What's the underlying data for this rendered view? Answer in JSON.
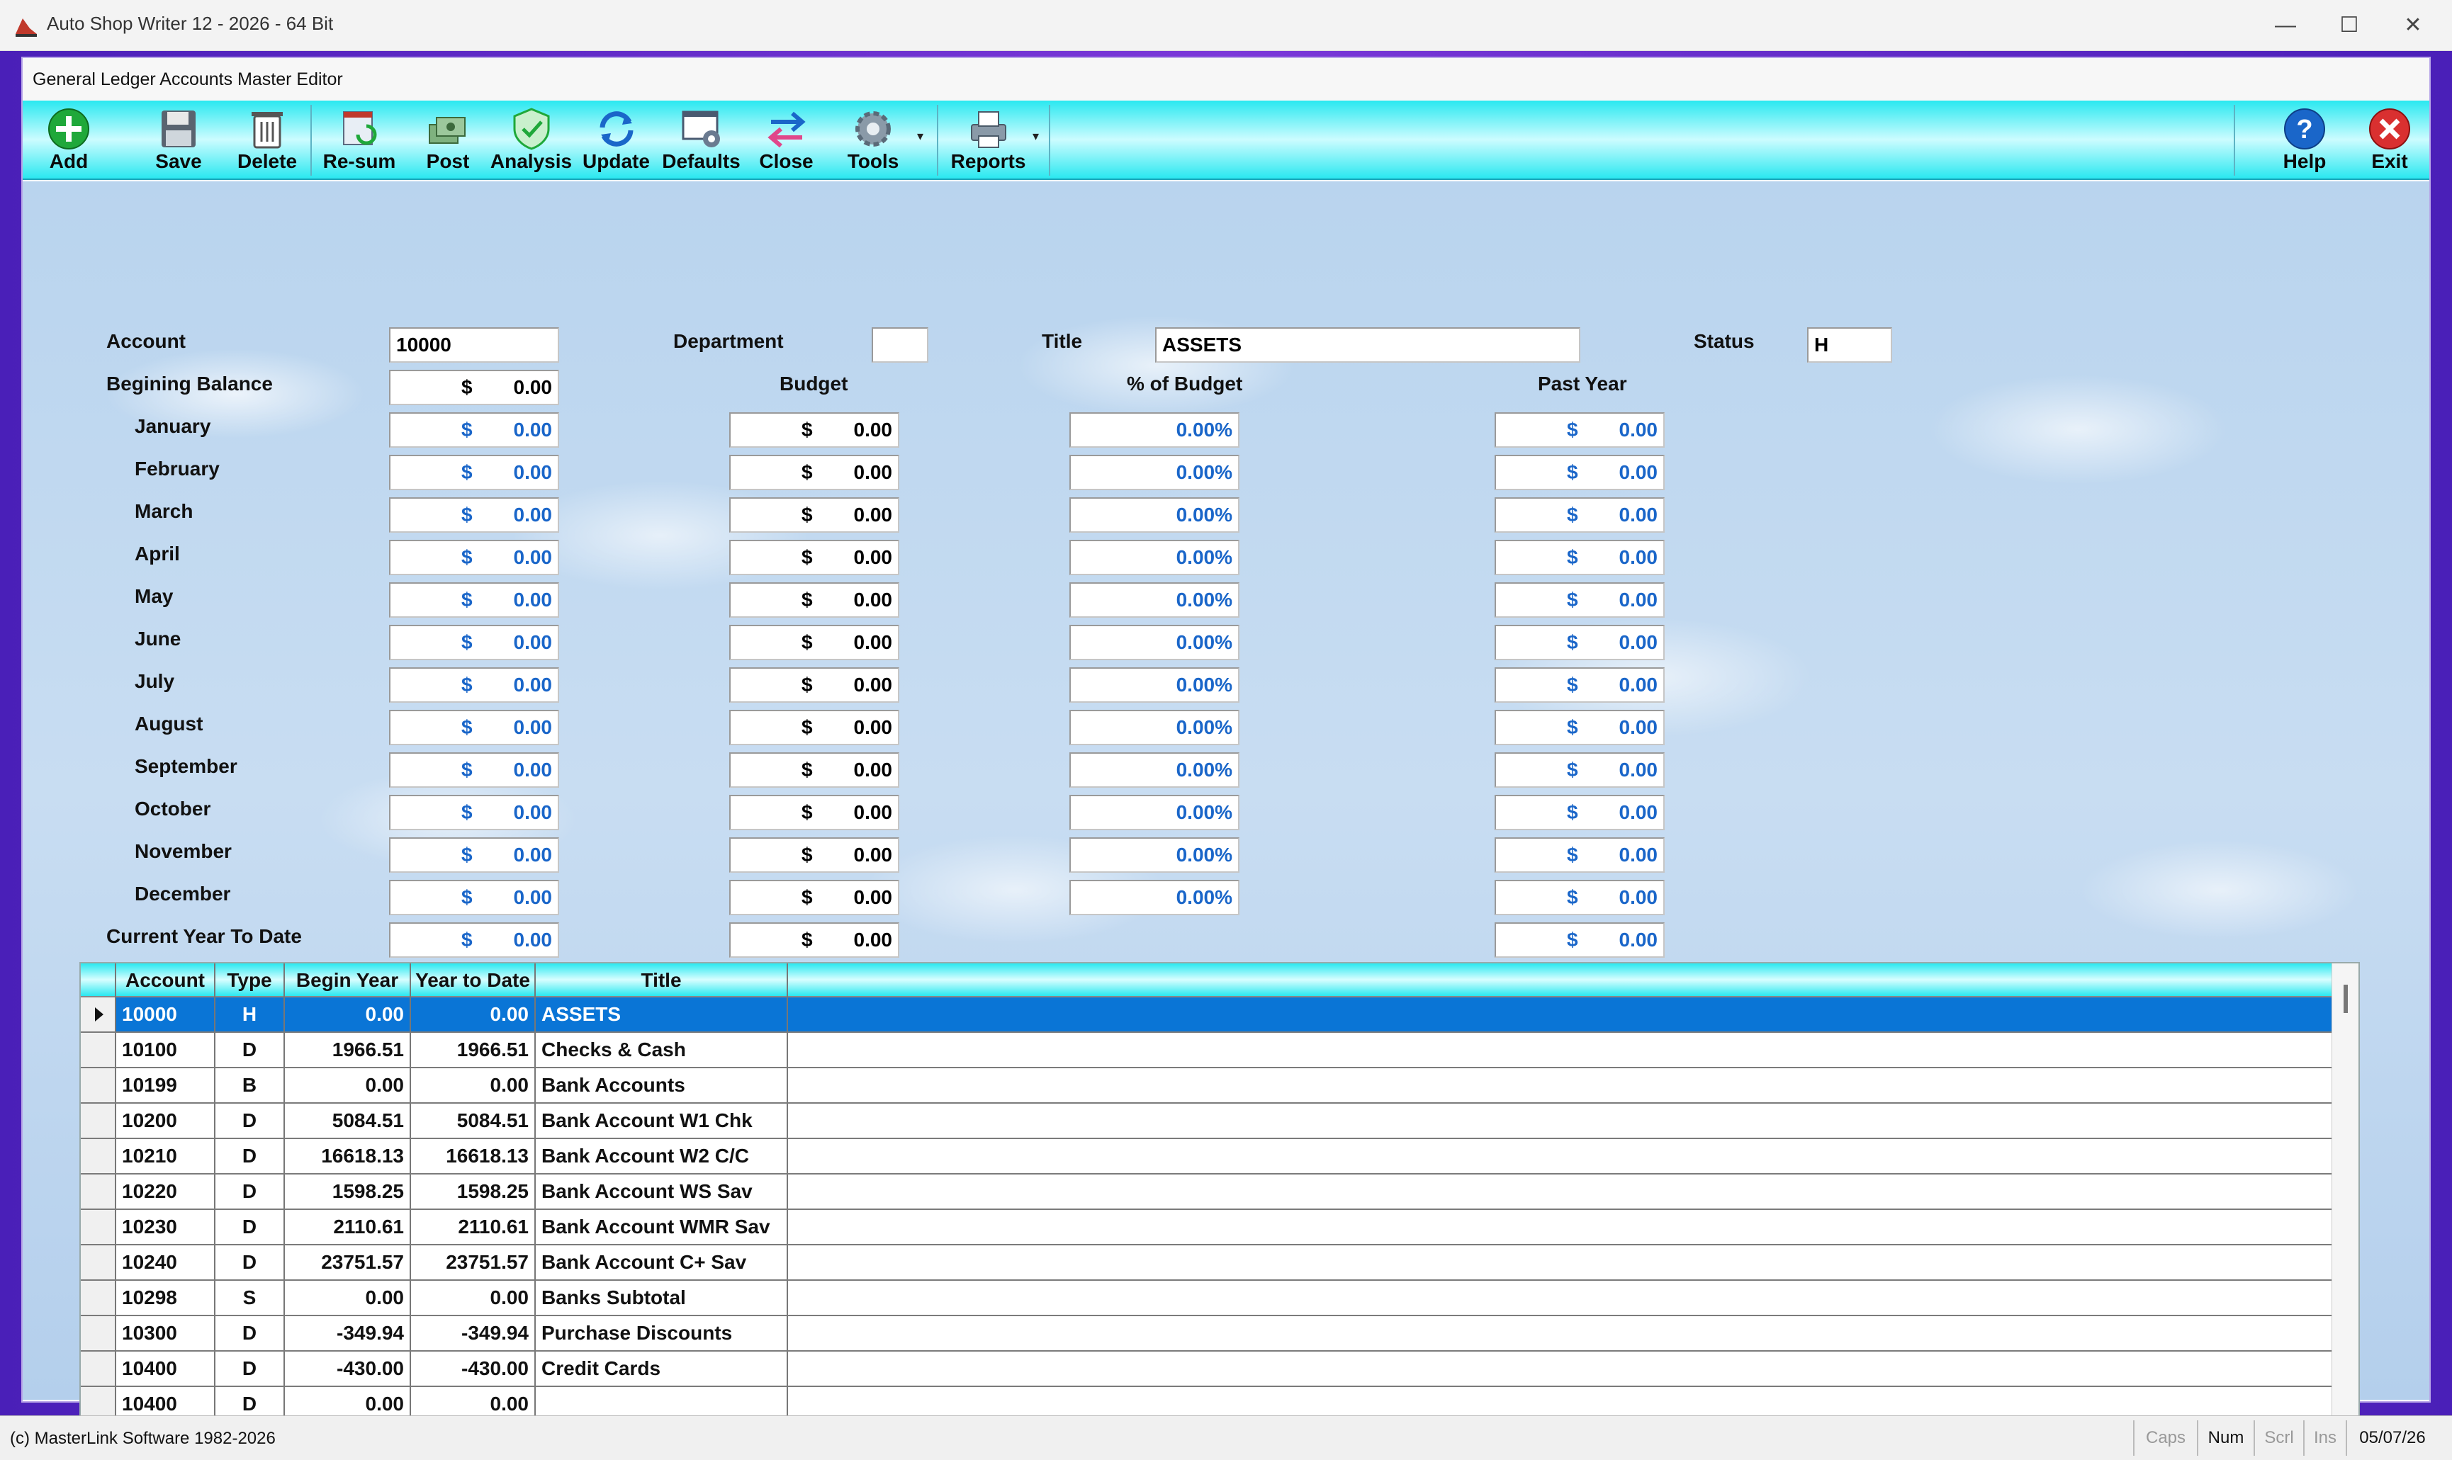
{
  "app": {
    "title": "Auto Shop Writer 12 - 2026  - 64 Bit",
    "window_controls": {
      "minimize": "—",
      "maximize": "☐",
      "close": "✕"
    }
  },
  "window": {
    "title": "General Ledger Accounts Master Editor"
  },
  "toolbar": {
    "items": [
      {
        "label": "Add",
        "icon": "add-icon"
      },
      {
        "label": "Save",
        "icon": "save-icon"
      },
      {
        "label": "Delete",
        "icon": "delete-icon"
      },
      {
        "label": "Re-sum",
        "icon": "resum-icon"
      },
      {
        "label": "Post",
        "icon": "post-icon"
      },
      {
        "label": "Analysis",
        "icon": "analysis-icon"
      },
      {
        "label": "Update",
        "icon": "update-icon"
      },
      {
        "label": "Defaults",
        "icon": "defaults-icon"
      },
      {
        "label": "Close",
        "icon": "close-period-icon"
      },
      {
        "label": "Tools",
        "icon": "tools-icon"
      },
      {
        "label": "Reports",
        "icon": "reports-icon"
      },
      {
        "label": "Help",
        "icon": "help-icon"
      },
      {
        "label": "Exit",
        "icon": "exit-icon"
      }
    ]
  },
  "form": {
    "account_label": "Account",
    "account_value": "10000",
    "department_label": "Department",
    "department_value": "",
    "title_label": "Title",
    "title_value": "ASSETS",
    "status_label": "Status",
    "status_value": "H",
    "begin_balance_label": "Begining Balance",
    "begin_balance_currency": "$",
    "begin_balance_value": "0.00",
    "budget_header": "Budget",
    "pct_budget_header": "% of Budget",
    "past_year_header": "Past Year",
    "ytd_label": "Current Year To Date",
    "currency": "$",
    "months": [
      {
        "name": "January",
        "amount": "0.00",
        "budget": "0.00",
        "pct": "0.00%",
        "past": "0.00"
      },
      {
        "name": "February",
        "amount": "0.00",
        "budget": "0.00",
        "pct": "0.00%",
        "past": "0.00"
      },
      {
        "name": "March",
        "amount": "0.00",
        "budget": "0.00",
        "pct": "0.00%",
        "past": "0.00"
      },
      {
        "name": "April",
        "amount": "0.00",
        "budget": "0.00",
        "pct": "0.00%",
        "past": "0.00"
      },
      {
        "name": "May",
        "amount": "0.00",
        "budget": "0.00",
        "pct": "0.00%",
        "past": "0.00"
      },
      {
        "name": "June",
        "amount": "0.00",
        "budget": "0.00",
        "pct": "0.00%",
        "past": "0.00"
      },
      {
        "name": "July",
        "amount": "0.00",
        "budget": "0.00",
        "pct": "0.00%",
        "past": "0.00"
      },
      {
        "name": "August",
        "amount": "0.00",
        "budget": "0.00",
        "pct": "0.00%",
        "past": "0.00"
      },
      {
        "name": "September",
        "amount": "0.00",
        "budget": "0.00",
        "pct": "0.00%",
        "past": "0.00"
      },
      {
        "name": "October",
        "amount": "0.00",
        "budget": "0.00",
        "pct": "0.00%",
        "past": "0.00"
      },
      {
        "name": "November",
        "amount": "0.00",
        "budget": "0.00",
        "pct": "0.00%",
        "past": "0.00"
      },
      {
        "name": "December",
        "amount": "0.00",
        "budget": "0.00",
        "pct": "0.00%",
        "past": "0.00"
      }
    ],
    "ytd": {
      "amount": "0.00",
      "budget": "0.00",
      "past": "0.00"
    }
  },
  "grid": {
    "columns": [
      "Account",
      "Type",
      "Begin Year",
      "Year to Date",
      "Title"
    ],
    "rows": [
      {
        "account": "10000",
        "type": "H",
        "begin": "0.00",
        "ytd": "0.00",
        "title": "ASSETS"
      },
      {
        "account": "10100",
        "type": "D",
        "begin": "1966.51",
        "ytd": "1966.51",
        "title": "Checks & Cash"
      },
      {
        "account": "10199",
        "type": "B",
        "begin": "0.00",
        "ytd": "0.00",
        "title": "Bank Accounts"
      },
      {
        "account": "10200",
        "type": "D",
        "begin": "5084.51",
        "ytd": "5084.51",
        "title": "Bank Account W1 Chk"
      },
      {
        "account": "10210",
        "type": "D",
        "begin": "16618.13",
        "ytd": "16618.13",
        "title": "Bank Account W2 C/C"
      },
      {
        "account": "10220",
        "type": "D",
        "begin": "1598.25",
        "ytd": "1598.25",
        "title": "Bank Account WS Sav"
      },
      {
        "account": "10230",
        "type": "D",
        "begin": "2110.61",
        "ytd": "2110.61",
        "title": "Bank Account WMR Sav"
      },
      {
        "account": "10240",
        "type": "D",
        "begin": "23751.57",
        "ytd": "23751.57",
        "title": "Bank Account C+ Sav"
      },
      {
        "account": "10298",
        "type": "S",
        "begin": "0.00",
        "ytd": "0.00",
        "title": "Banks Subtotal"
      },
      {
        "account": "10300",
        "type": "D",
        "begin": "-349.94",
        "ytd": "-349.94",
        "title": "Purchase Discounts"
      },
      {
        "account": "10400",
        "type": "D",
        "begin": "-430.00",
        "ytd": "-430.00",
        "title": "Credit Cards"
      },
      {
        "account": "10400",
        "type": "D",
        "begin": "0.00",
        "ytd": "0.00",
        "title": ""
      }
    ],
    "selected_row": 0
  },
  "statusbar": {
    "copyright": "(c) MasterLink Software 1982-2026",
    "caps": "Caps",
    "num": "Num",
    "scrl": "Scrl",
    "ins": "Ins",
    "date": "05/07/26"
  },
  "colors": {
    "toolbar": "#2ae8f0",
    "selection": "#0a75d6",
    "value_blue": "#1a66c9",
    "frame": "#6a35d0"
  }
}
